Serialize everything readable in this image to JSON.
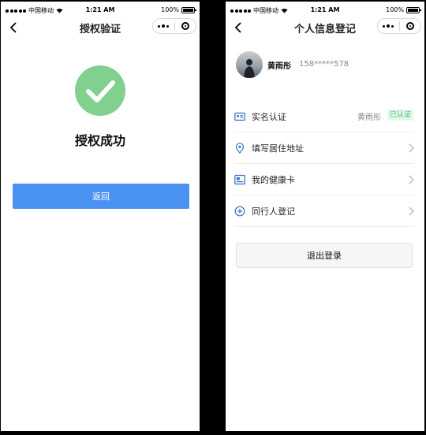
{
  "status_bar": {
    "carrier": "中国移动",
    "time": "1:21 AM",
    "battery": "100%"
  },
  "screen_left": {
    "title": "授权验证",
    "success_text": "授权成功",
    "return_label": "返回",
    "icons": {
      "back": "chevron-left-icon",
      "more": "more-dots-icon",
      "close": "target-icon",
      "success": "check-circle-icon"
    },
    "colors": {
      "success_green": "#82d090",
      "primary_blue": "#4a92f2"
    }
  },
  "screen_right": {
    "title": "个人信息登记",
    "user": {
      "name": "黄雨彤",
      "phone": "158*****578"
    },
    "menu": [
      {
        "label": "实名认证",
        "icon": "id-card-icon",
        "value": "黄雨彤",
        "badge": "已认证"
      },
      {
        "label": "填写居住地址",
        "icon": "location-pin-icon"
      },
      {
        "label": "我的健康卡",
        "icon": "health-card-icon"
      },
      {
        "label": "同行人登记",
        "icon": "plus-circle-icon"
      }
    ],
    "logout_label": "退出登录",
    "colors": {
      "icon_blue": "#2e6fc7",
      "verified_green": "#2fbf61"
    }
  }
}
